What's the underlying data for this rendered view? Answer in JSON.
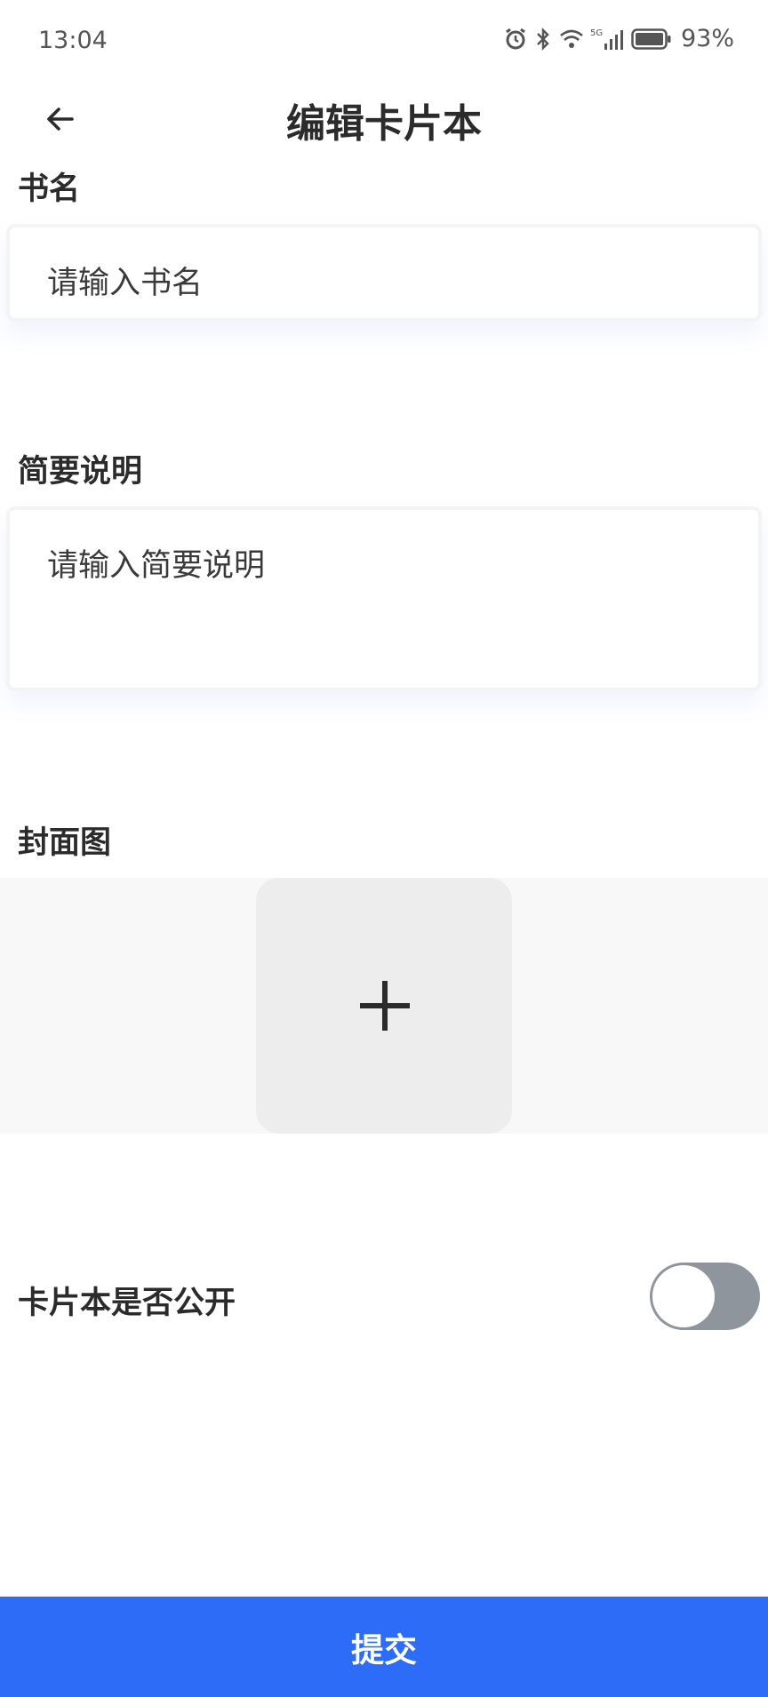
{
  "status_bar": {
    "time": "13:04",
    "network": "5G",
    "battery_percent": "93%"
  },
  "header": {
    "title": "编辑卡片本",
    "back_icon": "arrow-left-icon"
  },
  "form": {
    "book_name": {
      "label": "书名",
      "placeholder": "请输入书名",
      "value": ""
    },
    "description": {
      "label": "简要说明",
      "placeholder": "请输入简要说明",
      "value": ""
    },
    "cover": {
      "label": "封面图",
      "upload_icon": "plus-icon"
    },
    "public": {
      "label": "卡片本是否公开",
      "enabled": false
    }
  },
  "submit": {
    "label": "提交"
  },
  "colors": {
    "primary": "#2c6cf7",
    "toggle_off": "#8f959c",
    "upload_tile": "#ededed",
    "text": "#2b2b2b"
  }
}
